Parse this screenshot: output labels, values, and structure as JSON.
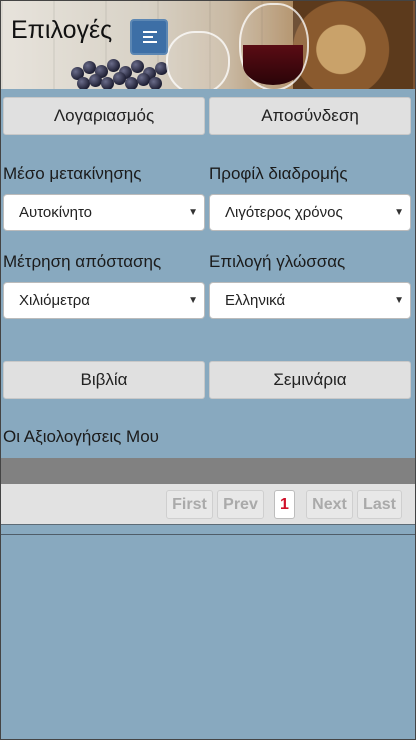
{
  "header": {
    "title": "Επιλογές",
    "menu_icon": "menu-lines-icon"
  },
  "account": {
    "account_label": "Λογαριασμός",
    "logout_label": "Αποσύνδεση"
  },
  "settings": {
    "transport_label": "Μέσο μετακίνησης",
    "transport_value": "Αυτοκίνητο",
    "route_label": "Προφίλ διαδρομής",
    "route_value": "Λιγότερος χρόνος",
    "distance_label": "Μέτρηση απόστασης",
    "distance_value": "Χιλιόμετρα",
    "language_label": "Επιλογή γλώσσας",
    "language_value": "Ελληνικά"
  },
  "nav": {
    "books_label": "Βιβλία",
    "seminars_label": "Σεμινάρια"
  },
  "ratings": {
    "title": "Οι Αξιολογήσεις Μου"
  },
  "pager": {
    "first": "First",
    "prev": "Prev",
    "current": "1",
    "next": "Next",
    "last": "Last"
  },
  "colors": {
    "background": "#88a9bf",
    "menu_button": "#3d6fa6",
    "active_page": "#d0102a"
  }
}
